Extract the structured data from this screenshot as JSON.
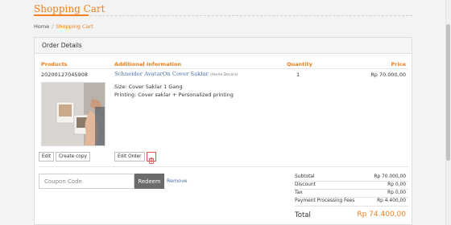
{
  "page": {
    "title": "Shopping Cart"
  },
  "breadcrumb": {
    "home": "Home",
    "separator": "/",
    "current": "Shopping Cart"
  },
  "panel": {
    "title": "Order Details"
  },
  "columns": {
    "products": "Products",
    "info": "Additional Information",
    "quantity": "Quantity",
    "price": "Price"
  },
  "item": {
    "sku": "20200127045908",
    "name": "Schneider AvatarOn Cover Saklar",
    "brand": "(Home Decors)",
    "size": "Size: Cover Saklar 1 Gang",
    "printing": "Printing: Cover saklar + Personalized printing",
    "quantity": "1",
    "price": "Rp 70.000,00",
    "image_icon": "product-photo"
  },
  "buttons": {
    "edit": "Edit",
    "create_copy": "Create copy",
    "edit_order": "Edit Order",
    "delete_icon": "trash-icon"
  },
  "coupon": {
    "placeholder": "Coupon Code",
    "value": "",
    "redeem": "Redeem",
    "remove": "Remove"
  },
  "summary": {
    "rows": [
      {
        "label": "Subtotal",
        "value": "Rp 70.000,00"
      },
      {
        "label": "Discount",
        "value": "Rp 0,00"
      },
      {
        "label": "Tax",
        "value": "Rp 0,00"
      },
      {
        "label": "Payment Processing Fees",
        "value": "Rp 4.400,00"
      }
    ],
    "total_label": "Total",
    "total_value": "Rp 74.400,00"
  },
  "colors": {
    "accent": "#f07f1d",
    "link": "#4a6fa5",
    "delete": "#d9534f",
    "redeem_bg": "#6b6b6b"
  }
}
